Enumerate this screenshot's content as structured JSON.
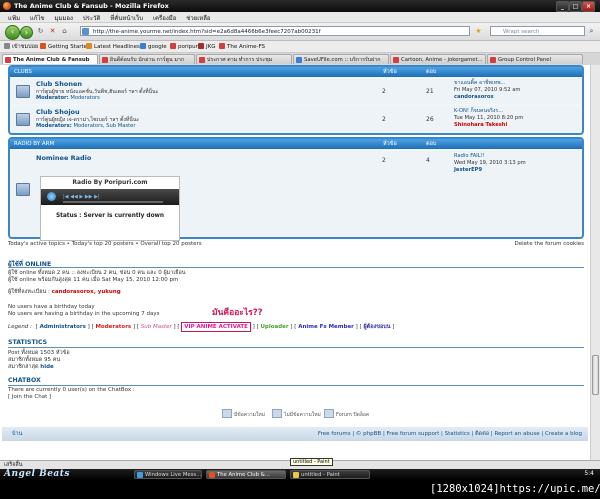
{
  "window": {
    "title": "The Anime Club &amp; Fansub - Mozilla Firefox",
    "min": "_",
    "max": "□",
    "close": "×"
  },
  "menu": [
    "แฟ้ม",
    "แก้ไข",
    "มุมมอง",
    "ประวัติ",
    "ที่คั่นหน้าเว็บ",
    "เครื่องมือ",
    "ช่วยเหลือ"
  ],
  "nav": {
    "back": "‹",
    "forward": "›",
    "reload": "↻",
    "stop": "✕",
    "home": "⌂",
    "url": "http://the-anime.yourme.net/index.htm?sid=e2a6d8a4466b6e3feec7207ab00231f",
    "search_placeholder": "Wrapt search"
  },
  "bookmarks": [
    {
      "label": "เข้าชมบ่อย",
      "color": "#888888"
    },
    {
      "label": "Getting Started",
      "color": "#d9531e"
    },
    {
      "label": "Latest Headlines",
      "color": "#e08a1e"
    },
    {
      "label": "google",
      "color": "#3b7dd8"
    },
    {
      "label": "poripuri",
      "color": "#d04040"
    },
    {
      "label": "JKG",
      "color": "#a03030"
    },
    {
      "label": "The Anime-FS",
      "color": "#d04040"
    }
  ],
  "tabs": [
    {
      "label": "The Anime Club &amp; Fansub",
      "active": true
    },
    {
      "label": "ยินดีต้อนรับ นักอ่าน การ์ตูน มาก",
      "active": false
    },
    {
      "label": "ประกาศ ตาม ทำการ ประชุม",
      "active": false
    },
    {
      "label": "SaveUFile.com :: บริการรับฝาก",
      "active": false
    },
    {
      "label": "Cartoon, Anime - jokergamet...",
      "active": false
    },
    {
      "label": "Group Control Panel",
      "active": false
    }
  ],
  "clubs_panel": {
    "header": "CLUBS",
    "col_topics": "หัวข้อ",
    "col_posts": "ตอบ",
    "forums": [
      {
        "title": "Club Shonen",
        "desc": "การ์ตูนผู้ชาย หนังแอคชั่น,วันพีช,ฮันเตอร์ ฯลฯ ตั้งที่นี่นะ",
        "mod_label": "Moderator:",
        "mods": "Moderators",
        "topics": "2",
        "posts": "21",
        "last_title": "ขาแอนติ๊ค อาชีพเทพ...",
        "last_date": "Fri May 07, 2010 9:52 am",
        "last_user": "candorasorox",
        "last_red": false
      },
      {
        "title": "Club Shojou",
        "desc": "การ์ตูนผู้หญิง เจ-ดราม่า,ไซเบอร์ ฯลฯ ตั้งที่นี่นะ",
        "mod_label": "Moderators:",
        "mods": "Moderators, Sub Master",
        "topics": "2",
        "posts": "26",
        "last_title": "K-ON! ก็จบคนจริงร...",
        "last_date": "Tue May 11, 2010 8:20 pm",
        "last_user": "Shinohara Takeshi",
        "last_red": true
      }
    ]
  },
  "radio_panel": {
    "header": "RADIO BY ARM",
    "col_topics": "หัวข้อ",
    "col_posts": "ตอบ",
    "forum": {
      "title": "Nominee Radio",
      "topics": "2",
      "posts": "4",
      "last_title": "Radio FAIL!!",
      "last_date": "Wed May 19, 2010 3:13 pm",
      "last_user": "JesterEP9"
    },
    "player": {
      "head": "Radio By Poripuri.com",
      "status": "Status : Server is currently down",
      "controls": "|◀  ◀◀  ▶  ▶▶  ▶|"
    }
  },
  "links": {
    "left": "Today's active topics • Today's top 20 posters • Overall top 20 posters",
    "right": "Delete the forum cookies"
  },
  "online": {
    "header": "ผู้ใช้ที่ ONLINE",
    "line1": "ผู้ใช้ online ทั้งหมด 2 คน :: ลงทะเบียน 2 คน, ซ่อน 0 คน และ 0 ผู้มาเยือน",
    "line2": "ผู้ใช้ online พร้อมกันสูงสุด 11 คน เมื่อ Sat May 15, 2010 12:00 pm",
    "label": "ผู้ใช้ที่ลงทะเบียน :",
    "users": "candorasorox, yukung",
    "bday1": "No users have a birthday today",
    "bday2": "No users are having a birthday in the upcoming 7 days"
  },
  "legend": {
    "label": "Legend :",
    "items": [
      {
        "text": "Administrators",
        "color": "#105289"
      },
      {
        "text": "Moderators",
        "color": "#d81b1b"
      },
      {
        "text": "Sub Master",
        "color": "#c0508a"
      },
      {
        "text": "VIP ANIME ACTIVATE",
        "color": "#e0169a"
      },
      {
        "text": "Uploader",
        "color": "#49a12b"
      },
      {
        "text": "Anime Fs Member",
        "color": "#2a2ac0"
      },
      {
        "text": "ผู้ต้องขอบน",
        "color": "#3030a0"
      }
    ],
    "annotation": "มันคืออะไร??"
  },
  "statistics": {
    "header": "STATISTICS",
    "line1": "Post ทั้งหมด 1503 หัวข้อ",
    "line2": "สมาชิกทั้งหมด 95 คน",
    "line3_label": "สมาชิกล่าสุด",
    "line3_user": "hide"
  },
  "chatbox": {
    "header": "CHATBOX",
    "line1": "There are currently 0 user(s) on the ChatBox :",
    "line2": "[ Join the Chat ]"
  },
  "icon_legend": [
    "มีข้อความใหม่",
    "ไม่มีข้อความใหม่",
    "Forum ปิดล็อค"
  ],
  "footer": {
    "left": "บ้าน",
    "right": "Free forums  |  © phpBB  |  Free forum support  |  Statistics  |  ติดต่อ  |  Report an abuse  |  Create a blog"
  },
  "status": "เสร็จสิ้น",
  "taskbar": {
    "brand": "Angel Beats",
    "tasks": [
      {
        "label": "Windows Live Mess...",
        "active": false
      },
      {
        "label": "The Anime Club &...",
        "active": true
      },
      {
        "label": "untitled - Paint",
        "active": false
      }
    ],
    "tooltip": "untitled - Paint",
    "clock": "5:4"
  },
  "watermark": "[1280x1024]https://upic.me/"
}
